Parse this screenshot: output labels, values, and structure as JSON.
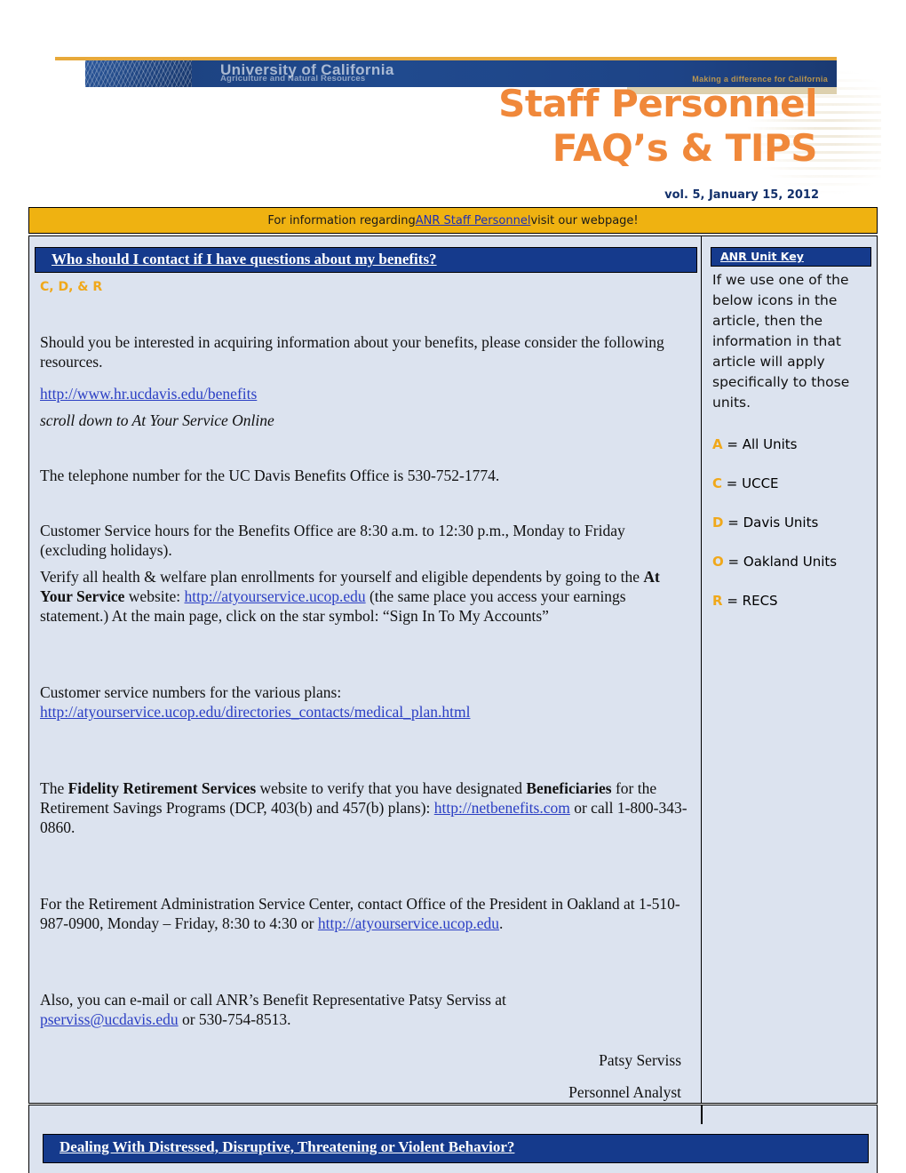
{
  "masthead": {
    "uc_name": "University of California",
    "uc_sub": "Agriculture and Natural Resources",
    "uc_tagline": "Making a difference for California",
    "title_line1": "Staff Personnel",
    "title_line2": "FAQ’s & TIPS",
    "volume": "vol. 5, January 15, 2012"
  },
  "notice": {
    "before": "For information regarding ",
    "link": "ANR Staff Personnel",
    "after": " visit our webpage!"
  },
  "article": {
    "heading": "Who should I contact if I have questions about my benefits?",
    "unit_tag": "C, D, & R",
    "p1": "Should you be interested in acquiring information about your benefits, please consider the following resources.",
    "link1": "http://www.hr.ucdavis.edu/benefits",
    "p2_italic": "scroll down to At Your Service Online",
    "p3": "The telephone number for the UC Davis Benefits Office is 530-752-1774.",
    "p4": "Customer Service hours for the Benefits Office are 8:30 a.m. to 12:30 p.m., Monday to Friday (excluding holidays).",
    "p5_a": "Verify all health & welfare plan enrollments for yourself and eligible dependents by going to the ",
    "p5_bold": "At Your Service",
    "p5_b": " website: ",
    "p5_link": "http://atyourservice.ucop.edu",
    "p5_c": "  (the same place you access your earnings statement.)  At the main page, click on the star symbol: “Sign In To My Accounts”",
    "p6": "Customer service numbers for the various plans:",
    "link2": "http://atyourservice.ucop.edu/directories_contacts/medical_plan.html",
    "p7_a": "The ",
    "p7_bold1": "Fidelity Retirement Services",
    "p7_b": " website to verify that you have designated ",
    "p7_bold2": "Beneficiaries",
    "p7_c": " for the Retirement Savings Programs (DCP, 403(b) and 457(b) plans): ",
    "p7_link": "http://netbenefits.com",
    "p7_d": " or call 1-800-343-0860.",
    "p8_a": "For the Retirement Administration Service Center, contact Office of the President in Oakland at 1-510-987-0900, Monday – Friday, 8:30 to 4:30 or ",
    "p8_link": "http://atyourservice.ucop.edu",
    "p8_b": ".",
    "p9_a": "Also, you can e-mail or call ANR’s Benefit Representative Patsy Serviss at ",
    "p9_link": "pserviss@ucdavis.edu",
    "p9_b": " or 530-754-8513.",
    "signature_name": "Patsy Serviss",
    "signature_title": "Personnel Analyst"
  },
  "unit_key": {
    "heading": "ANR Unit Key",
    "description": "If we use one of the below icons in the article, then the information in that article will apply specifically to those units.",
    "items": [
      {
        "letter": "A",
        "label": "= All Units"
      },
      {
        "letter": "C",
        "label": "= UCCE"
      },
      {
        "letter": "D",
        "label": "= Davis Units"
      },
      {
        "letter": "O",
        "label": "= Oakland Units"
      },
      {
        "letter": "R",
        "label": "= RECS"
      }
    ]
  },
  "next_article": {
    "heading": "Dealing With Distressed, Disruptive, Threatening or Violent Behavior?"
  },
  "colors": {
    "header_blue": "#153a8c",
    "banner_blue": "#1d4382",
    "title_orange": "#f0883a",
    "notice_yellow": "#efb211",
    "page_bg": "#dce3ef",
    "unit_gold": "#f0a81a",
    "link_blue": "#2b3fc4",
    "tan": "#ddd0ae"
  }
}
